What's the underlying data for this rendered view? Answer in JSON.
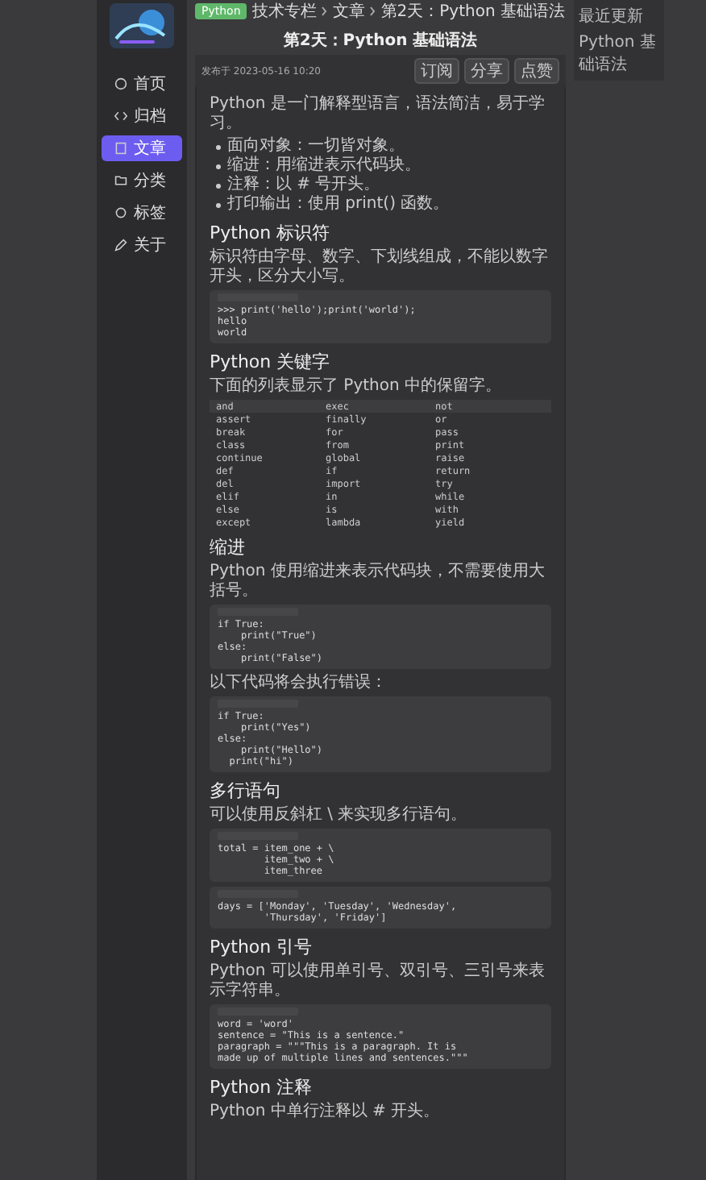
{
  "sidebar": {
    "items": [
      {
        "label": "首页",
        "kind": "home",
        "selected": false
      },
      {
        "label": "归档",
        "kind": "code",
        "selected": false
      },
      {
        "label": "文章",
        "kind": "doc",
        "selected": true
      },
      {
        "label": "分类",
        "kind": "folder",
        "selected": false
      },
      {
        "label": "标签",
        "kind": "tag",
        "selected": false
      },
      {
        "label": "关于",
        "kind": "edit",
        "selected": false
      }
    ]
  },
  "breadcrumb": {
    "tag": "Python",
    "items": [
      "技术专栏",
      "文章",
      "第2天：Python 基础语法"
    ]
  },
  "article": {
    "title": "第2天：Python 基础语法",
    "meta": "发布于 2023-05-16 10:20",
    "actions": [
      "订阅",
      "分享",
      "点赞"
    ],
    "sections": [
      {
        "blocks": [
          {
            "kind": "p",
            "text": "Python 是一门解释型语言，语法简洁，易于学习。"
          },
          {
            "kind": "ul",
            "items": [
              "面向对象：一切皆对象。",
              "缩进：用缩进表示代码块。",
              "注释：以 # 号开头。",
              "打印输出：使用 print() 函数。"
            ]
          }
        ]
      },
      {
        "heading": "Python 标识符",
        "blocks": [
          {
            "kind": "p",
            "text": "标识符由字母、数字、下划线组成，不能以数字开头，区分大小写。"
          },
          {
            "kind": "code",
            "lines": [
              ">>> print('hello');print('world');",
              "hello",
              "world"
            ]
          }
        ]
      },
      {
        "heading": "Python 关键字",
        "blocks": [
          {
            "kind": "p",
            "text": "下面的列表显示了 Python 中的保留字。"
          },
          {
            "kind": "table",
            "rows": [
              [
                "and",
                "exec",
                "not"
              ],
              [
                "assert",
                "finally",
                "or"
              ],
              [
                "break",
                "for",
                "pass"
              ],
              [
                "class",
                "from",
                "print"
              ],
              [
                "continue",
                "global",
                "raise"
              ],
              [
                "def",
                "if",
                "return"
              ],
              [
                "del",
                "import",
                "try"
              ],
              [
                "elif",
                "in",
                "while"
              ],
              [
                "else",
                "is",
                "with"
              ],
              [
                "except",
                "lambda",
                "yield"
              ]
            ]
          }
        ]
      },
      {
        "heading": "缩进",
        "blocks": [
          {
            "kind": "p",
            "text": "Python 使用缩进来表示代码块，不需要使用大括号。"
          },
          {
            "kind": "code",
            "lines": [
              "if True:",
              "    print(\"True\")",
              "else:",
              "    print(\"False\")"
            ]
          },
          {
            "kind": "p",
            "text": "以下代码将会执行错误："
          },
          {
            "kind": "code",
            "lines": [
              "if True:",
              "    print(\"Yes\")",
              "else:",
              "    print(\"Hello\")",
              "  print(\"hi\")"
            ]
          }
        ]
      },
      {
        "heading": "多行语句",
        "blocks": [
          {
            "kind": "p",
            "text": "可以使用反斜杠 \\ 来实现多行语句。"
          },
          {
            "kind": "code",
            "lines": [
              "total = item_one + \\",
              "        item_two + \\",
              "        item_three"
            ]
          },
          {
            "kind": "code",
            "lines": [
              "days = ['Monday', 'Tuesday', 'Wednesday',",
              "        'Thursday', 'Friday']"
            ]
          }
        ]
      },
      {
        "heading": "Python 引号",
        "blocks": [
          {
            "kind": "p",
            "text": "Python 可以使用单引号、双引号、三引号来表示字符串。"
          },
          {
            "kind": "code",
            "lines": [
              "word = 'word'",
              "sentence = \"This is a sentence.\"",
              "paragraph = \"\"\"This is a paragraph. It is",
              "made up of multiple lines and sentences.\"\"\""
            ]
          }
        ]
      },
      {
        "heading": "Python 注释",
        "blocks": [
          {
            "kind": "p",
            "text": "Python 中单行注释以 # 开头。"
          }
        ]
      }
    ]
  },
  "aside": {
    "lines": [
      "最近更新",
      "Python 基础语法"
    ]
  }
}
